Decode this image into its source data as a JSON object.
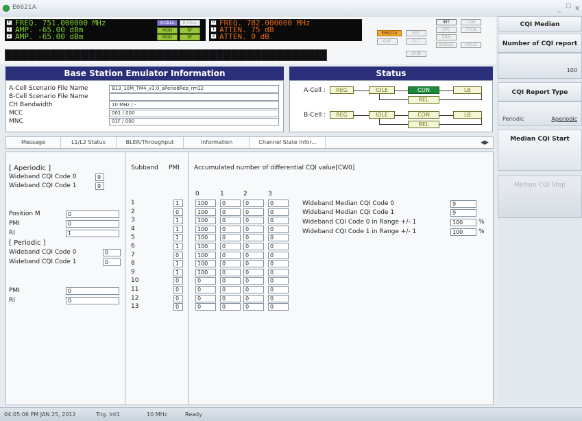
{
  "window": {
    "title": "E6621A",
    "minimize": "_",
    "restore": "☐",
    "close": "x"
  },
  "instrument": {
    "ch0_freq": "FREQ.   751.000000 MHz",
    "ch1_amp": "AMP.       -65.00 dBm",
    "ch2_amp": "AMP.       -65.00 dBm",
    "b_freq": "FREQ.   782.000000 MHz",
    "b_atten1": "ATTEN.         75 dB",
    "b_atten2": "ATTEN.          0 dB",
    "btn_acell": "A-CELL",
    "btn_bcell": "B-CELL",
    "btn_mod1": "MOD",
    "btn_rf1": "RF",
    "btn_mod2": "MOD",
    "btn_rf2": "RF",
    "btn_e6621a": "E6621A",
    "btn_rst": "RST",
    "btn_ovf": "OVF",
    "btn_dc": "D.C",
    "btn_shift": "Shift",
    "btn_int": "INT",
    "btn_10m": "10M",
    "btn_epc": "EPC",
    "btn_ttcn": "TTCN",
    "btn_err": "ERR",
    "btn_sincle": "SINGLE",
    "btn_hold": "HOLD"
  },
  "bsinfo": {
    "header": "Base Station Emulator Information",
    "rows": [
      {
        "label": "A-Cell Scenario File Name",
        "value": "B13_10M_TM4_v3.0_aPeriodRep_rm12"
      },
      {
        "label": "B-Cell Scenario File Name",
        "value": ""
      },
      {
        "label": "CH Bandwidth",
        "value": "10 MHz / -"
      },
      {
        "label": "MCC",
        "value": "001 / 000"
      },
      {
        "label": "MNC",
        "value": "01F / 000"
      }
    ]
  },
  "status": {
    "header": "Status",
    "acell": {
      "label": "A-Cell :",
      "reg": "REG",
      "idle": "IDLE",
      "con": "CON",
      "lb": "LB",
      "rel": "REL"
    },
    "bcell": {
      "label": "B-Cell :",
      "reg": "REG",
      "idle": "IDLE",
      "con": "CON",
      "lb": "LB",
      "rel": "REL"
    }
  },
  "tabs": {
    "items": [
      "Message",
      "L1/L2 Status",
      "BLER/Throughput",
      "Information",
      "Channel State Infor..."
    ],
    "scroll": "◀▶"
  },
  "aperiodic": {
    "title": "[ Aperiodic ]",
    "wb0_label": "Wideband CQI Code 0",
    "wb0": "9",
    "wb1_label": "Wideband CQI Code 1",
    "wb1": "9",
    "pos_label": "Position M",
    "pos": "0",
    "pmi_label": "PMI",
    "pmi": "0",
    "ri_label": "RI",
    "ri": "1"
  },
  "periodic": {
    "title": "[ Periodic ]",
    "wb0_label": "Wideband CQI Code 0",
    "wb0": "0",
    "wb1_label": "Wideband CQI Code 1",
    "wb1": "0",
    "pmi_label": "PMI",
    "pmi": "0",
    "ri_label": "RI",
    "ri": "0"
  },
  "subband": {
    "hdr_subband": "Subband",
    "hdr_pmi": "PMI",
    "rows": [
      {
        "n": "1",
        "pmi": "1"
      },
      {
        "n": "2",
        "pmi": "0"
      },
      {
        "n": "3",
        "pmi": "1"
      },
      {
        "n": "4",
        "pmi": "1"
      },
      {
        "n": "5",
        "pmi": "1"
      },
      {
        "n": "6",
        "pmi": "1"
      },
      {
        "n": "7",
        "pmi": "0"
      },
      {
        "n": "8",
        "pmi": "1"
      },
      {
        "n": "9",
        "pmi": "1"
      },
      {
        "n": "10",
        "pmi": "0"
      },
      {
        "n": "11",
        "pmi": "0"
      },
      {
        "n": "12",
        "pmi": "0"
      },
      {
        "n": "13",
        "pmi": "0"
      }
    ]
  },
  "accum": {
    "title": "Accumulated number of differential CQI value[CW0]",
    "cols": [
      "0",
      "1",
      "2",
      "3"
    ],
    "rows": [
      [
        "100",
        "0",
        "0",
        "0"
      ],
      [
        "100",
        "0",
        "0",
        "0"
      ],
      [
        "100",
        "0",
        "0",
        "0"
      ],
      [
        "100",
        "0",
        "0",
        "0"
      ],
      [
        "100",
        "0",
        "0",
        "0"
      ],
      [
        "100",
        "0",
        "0",
        "0"
      ],
      [
        "100",
        "0",
        "0",
        "0"
      ],
      [
        "100",
        "0",
        "0",
        "0"
      ],
      [
        "100",
        "0",
        "0",
        "0"
      ],
      [
        "0",
        "0",
        "0",
        "0"
      ],
      [
        "0",
        "0",
        "0",
        "0"
      ],
      [
        "0",
        "0",
        "0",
        "0"
      ],
      [
        "0",
        "0",
        "0",
        "0"
      ]
    ]
  },
  "median": {
    "m0_label": "Wideband Median CQI Code 0",
    "m0": "9",
    "m1_label": "Wideband Median CQI Code 1",
    "m1": "9",
    "r0_label": "Wideband CQI Code 0 in Range +/- 1",
    "r0": "100",
    "r0_unit": "%",
    "r1_label": "Wideband CQI Code 1 in Range +/- 1",
    "r1": "100",
    "r1_unit": "%"
  },
  "sidebar": {
    "title": "CQI Median",
    "num_report_label": "Number of CQI report",
    "num_report_value": "100",
    "report_type_label": "CQI Report Type",
    "type_periodic": "Periodic",
    "type_aperiodic": "Aperiodic",
    "start": "Median CQI Start",
    "stop": "Median CQI Stop"
  },
  "statusbar": {
    "datetime": "04:05:06 PM JAN 25, 2012",
    "trig": "Trig. Int1",
    "bw": "10 MHz",
    "state": "Ready"
  }
}
